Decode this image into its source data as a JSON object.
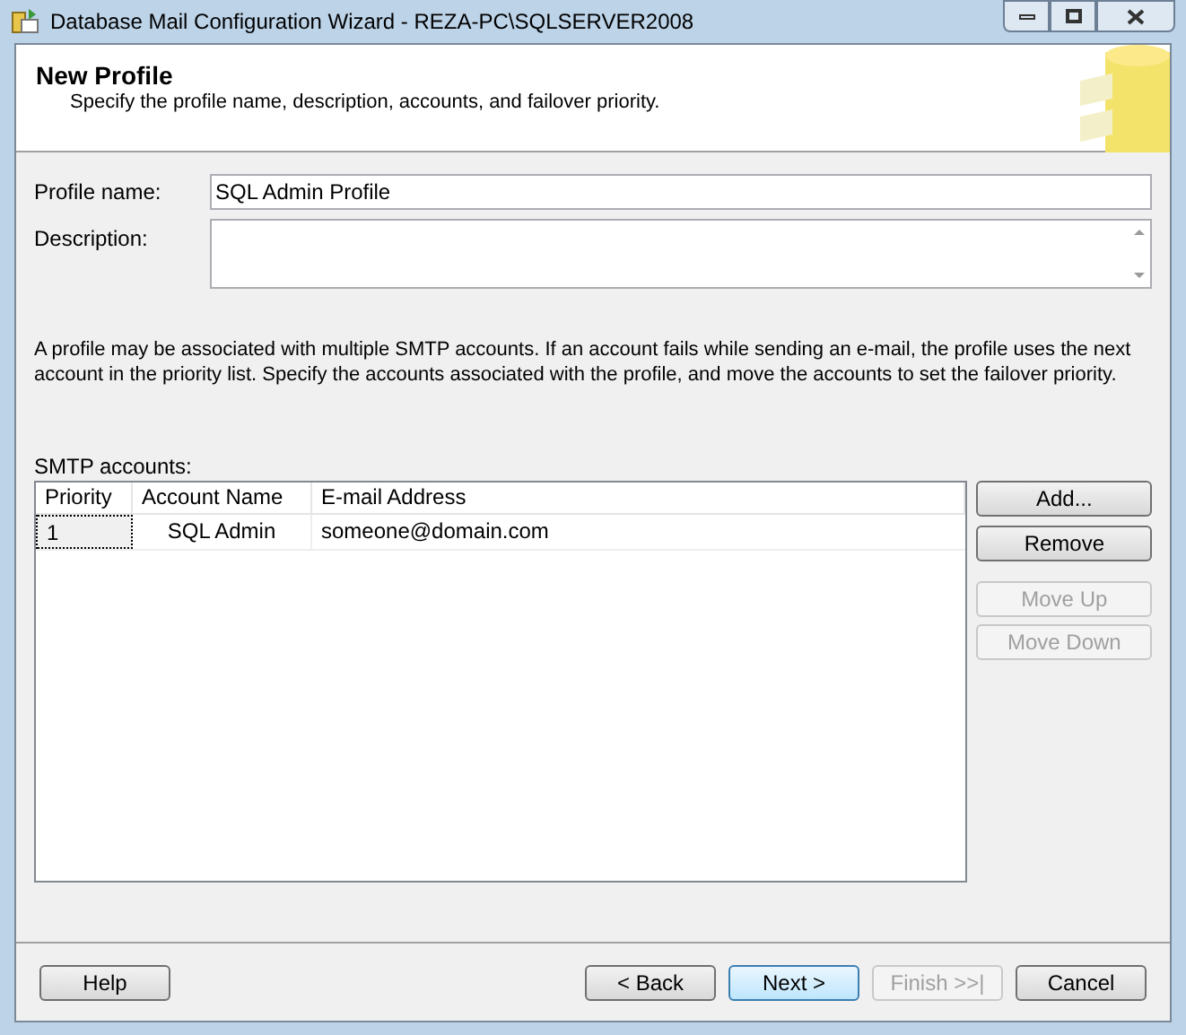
{
  "window": {
    "title": "Database Mail Configuration Wizard - REZA-PC\\SQLSERVER2008"
  },
  "header": {
    "title": "New Profile",
    "subtitle": "Specify the profile name, description, accounts, and failover priority."
  },
  "profile_name": {
    "label": "Profile name:",
    "value": "SQL Admin Profile"
  },
  "description": {
    "label": "Description:"
  },
  "info": "A profile may be associated with multiple SMTP accounts. If an account fails while sending an e-mail, the profile uses the next account in the priority list. Specify the accounts associated with the profile, and move the accounts to set the failover priority.",
  "smtp": {
    "label": "SMTP accounts:",
    "columns": [
      "Priority",
      "Account Name",
      "E-mail Address"
    ],
    "rows": [
      [
        "1",
        "SQL Admin",
        "someone@domain.com"
      ]
    ],
    "buttons": [
      {
        "label": "Add...",
        "disabled": false
      },
      {
        "label": "Remove",
        "disabled": false
      },
      {
        "label": "Move Up",
        "disabled": true
      },
      {
        "label": "Move Down",
        "disabled": true
      }
    ]
  },
  "footer": {
    "buttons": [
      {
        "label": "Help",
        "disabled": false,
        "default": false
      },
      {
        "label": "< Back",
        "disabled": false,
        "default": false
      },
      {
        "label": "Next >",
        "disabled": false,
        "default": true
      },
      {
        "label": "Finish >>|",
        "disabled": true,
        "default": false
      },
      {
        "label": "Cancel",
        "disabled": false,
        "default": false
      }
    ]
  }
}
